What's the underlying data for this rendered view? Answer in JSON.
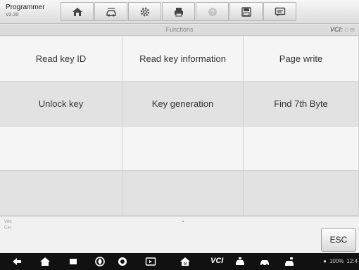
{
  "header": {
    "app_title": "Programmer",
    "version": "V2.20",
    "tools": [
      {
        "icon": "home-icon"
      },
      {
        "icon": "vehicle-swap-icon"
      },
      {
        "icon": "settings-icon"
      },
      {
        "icon": "print-icon"
      },
      {
        "icon": "help-icon",
        "disabled": true
      },
      {
        "icon": "save-icon"
      },
      {
        "icon": "data-logging-icon"
      }
    ]
  },
  "subheader": {
    "title": "Functions",
    "vci_label": "VCI:",
    "vci_status": "⎔ BI"
  },
  "functions": [
    {
      "label": "Read key ID"
    },
    {
      "label": "Read key information"
    },
    {
      "label": "Page write"
    },
    {
      "label": "Unlock key"
    },
    {
      "label": "Key generation"
    },
    {
      "label": "Find 7th Byte"
    },
    {
      "label": ""
    },
    {
      "label": ""
    },
    {
      "label": ""
    },
    {
      "label": ""
    },
    {
      "label": ""
    },
    {
      "label": ""
    }
  ],
  "info": {
    "vin_label": "VIN:",
    "car_label": "Car:",
    "esc_label": "ESC"
  },
  "navbar": {
    "vci_label": "VCI",
    "battery": "100%",
    "time": "12:4"
  },
  "colors": {
    "accent": "#333333",
    "row_light": "#f5f5f5",
    "row_dark": "#e2e2e2",
    "navbar": "#111111"
  }
}
